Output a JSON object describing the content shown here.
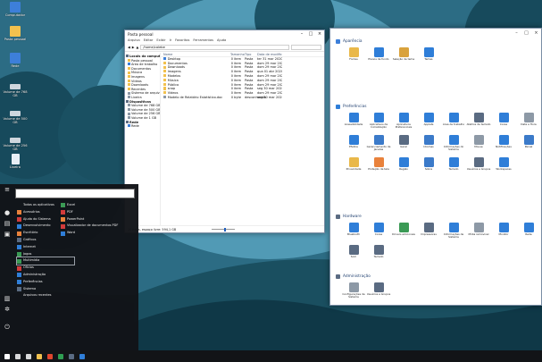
{
  "desktop": {
    "icons": [
      {
        "label": "Computador",
        "color": "#3d7fd9"
      },
      {
        "label": "Pasta pessoal",
        "color": "#f2c14e"
      },
      {
        "label": "Rede",
        "color": "#3d7fd9"
      },
      {
        "label": "Volume de 768 GB",
        "color": "#cfd6dd"
      },
      {
        "label": "Volume de 500 GB",
        "color": "#cfd6dd"
      },
      {
        "label": "Volume de 256 GB",
        "color": "#cfd6dd"
      },
      {
        "label": "Lixeira",
        "color": "#e8eef5"
      }
    ]
  },
  "explorer": {
    "title": "Pasta pessoal",
    "menu": [
      "Arquivo",
      "Editar",
      "Exibir",
      "Ir",
      "Favoritos",
      "Ferramentas",
      "Ajuda"
    ],
    "address": "/home/calebe",
    "nav": [
      {
        "label": "Locais do computador",
        "header": true,
        "color": "#5a6b82"
      },
      {
        "label": "Pasta pessoal",
        "color": "#f2c14e"
      },
      {
        "label": "Área de trabalho",
        "color": "#3d7fd9"
      },
      {
        "label": "Documentos",
        "color": "#f2c14e"
      },
      {
        "label": "Música",
        "color": "#f2c14e"
      },
      {
        "label": "Imagens",
        "color": "#f2c14e"
      },
      {
        "label": "Vídeos",
        "color": "#f2c14e"
      },
      {
        "label": "Downloads",
        "color": "#f2c14e"
      },
      {
        "label": "Recentes",
        "color": "#f2c14e"
      },
      {
        "label": "Sistema de arquivos",
        "color": "#8d99a6"
      },
      {
        "label": "Lixeira",
        "color": "#8d99a6"
      },
      {
        "label": "Dispositivos",
        "header": true,
        "color": "#5a6b82"
      },
      {
        "label": "Volume de 768 GB",
        "color": "#8d99a6"
      },
      {
        "label": "Volume de 500 GB",
        "color": "#8d99a6"
      },
      {
        "label": "Volume de 256 GB",
        "color": "#8d99a6"
      },
      {
        "label": "Volume de 1 GB",
        "color": "#8d99a6"
      },
      {
        "label": "Rede",
        "header": true,
        "color": "#5a6b82"
      },
      {
        "label": "Rede",
        "color": "#3d7fd9"
      }
    ],
    "columns": [
      "Nome",
      "Tamanho",
      "Tipo",
      "Data de modificação"
    ],
    "files": [
      {
        "name": "Desktop",
        "size": "0 item",
        "type": "Pasta",
        "date": "ter 31 mar 2020 23:00:39",
        "color": "#3d7fd9"
      },
      {
        "name": "Documentos",
        "size": "0 item",
        "type": "Pasta",
        "date": "dom 29 mar 2020 22:51:11",
        "color": "#f2c14e"
      },
      {
        "name": "Downloads",
        "size": "0 item",
        "type": "Pasta",
        "date": "dom 29 mar 2020 22:51:11",
        "color": "#f2c14e"
      },
      {
        "name": "Imagens",
        "size": "0 item",
        "type": "Pasta",
        "date": "qua 01 abr 2020 00:03:56",
        "color": "#f2c14e"
      },
      {
        "name": "Modelos",
        "size": "0 item",
        "type": "Pasta",
        "date": "dom 29 mar 2020 22:51:11",
        "color": "#f2c14e"
      },
      {
        "name": "Música",
        "size": "0 item",
        "type": "Pasta",
        "date": "dom 29 mar 2020 22:51:11",
        "color": "#f2c14e"
      },
      {
        "name": "Público",
        "size": "0 item",
        "type": "Pasta",
        "date": "dom 29 mar 2020 22:51:11",
        "color": "#f2c14e"
      },
      {
        "name": "snap",
        "size": "0 item",
        "type": "Pasta",
        "date": "seg 30 mar 2020 01:44:36",
        "color": "#f2c14e"
      },
      {
        "name": "Vídeos",
        "size": "0 item",
        "type": "Pasta",
        "date": "dom 29 mar 2020 22:51:11",
        "color": "#f2c14e"
      },
      {
        "name": "Modelo de Relatório Estatístico.doc",
        "size": "0 byte",
        "type": "desconhecido",
        "date": "seg 30 mar 2020 00:35:52",
        "color": "#8d99a6"
      }
    ],
    "status": "10 itens, espaço livre: 594,1 GB"
  },
  "control_panel": {
    "sections": [
      {
        "title": "Aparência",
        "color": "#3d7fd9",
        "items": [
          {
            "label": "Fontes",
            "color": "#e9b84a"
          },
          {
            "label": "Planos de fundo",
            "color": "#2f7ed8"
          },
          {
            "label": "Seleção de tema",
            "color": "#d9a23c"
          },
          {
            "label": "Temas",
            "color": "#2f7ed8"
          }
        ]
      },
      {
        "title": "Preferências",
        "color": "#2f7ed8",
        "items": [
          {
            "label": "Acessibilidade",
            "color": "#2f7ed8"
          },
          {
            "label": "Aplicativos de Inicialização",
            "color": "#2f7ed8"
          },
          {
            "label": "Aplicativos Preferenciais",
            "color": "#2f7ed8"
          },
          {
            "label": "Applets",
            "color": "#2f7ed8"
          },
          {
            "label": "Área de trabalho",
            "color": "#2f7ed8"
          },
          {
            "label": "Atalhos de teclado",
            "color": "#5a6b82"
          },
          {
            "label": "Cores",
            "color": "#2f7ed8"
          },
          {
            "label": "Data e Hora",
            "color": "#8d99a6"
          },
          {
            "label": "Efeitos",
            "color": "#2f7ed8"
          },
          {
            "label": "Gerenciamento de Janelas",
            "color": "#3b7ac9"
          },
          {
            "label": "Geral",
            "color": "#5a6b82"
          },
          {
            "label": "Idiomas",
            "color": "#3b7ac9"
          },
          {
            "label": "Informações do Sistema",
            "color": "#2f7ed8"
          },
          {
            "label": "Mouse",
            "color": "#8d99a6"
          },
          {
            "label": "Notificações",
            "color": "#2f7ed8"
          },
          {
            "label": "Painel",
            "color": "#3b7ac9"
          },
          {
            "label": "Privacidade",
            "color": "#e9b84a"
          },
          {
            "label": "Proteção de tela",
            "color": "#e9823c"
          },
          {
            "label": "Região",
            "color": "#2f7ed8"
          },
          {
            "label": "Sobre",
            "color": "#3b7ac9"
          },
          {
            "label": "Teclado",
            "color": "#2f7ed8"
          },
          {
            "label": "Usuários e Grupos",
            "color": "#5a6b82"
          },
          {
            "label": "Workspaces",
            "color": "#2f7ed8"
          }
        ]
      },
      {
        "title": "Hardware",
        "color": "#5a6b82",
        "items": [
          {
            "label": "Bluetooth",
            "color": "#2f7ed8"
          },
          {
            "label": "Cores",
            "color": "#2f7ed8"
          },
          {
            "label": "Drivers adicionais",
            "color": "#3b9a55"
          },
          {
            "label": "Impressoras",
            "color": "#5a6b82"
          },
          {
            "label": "Informações de Sistema",
            "color": "#2f7ed8"
          },
          {
            "label": "Mídia removível",
            "color": "#8d99a6"
          },
          {
            "label": "Monitor",
            "color": "#2f7ed8"
          },
          {
            "label": "Rede",
            "color": "#2f7ed8"
          },
          {
            "label": "Som",
            "color": "#5a6b82"
          },
          {
            "label": "Teclado",
            "color": "#5a6b82"
          }
        ]
      },
      {
        "title": "Administração",
        "color": "#5a6b82",
        "items": [
          {
            "label": "Configurações de Sistema",
            "color": "#8d99a6"
          },
          {
            "label": "Usuários e Grupos",
            "color": "#5a6b82"
          }
        ]
      }
    ]
  },
  "startmenu": {
    "col1": [
      {
        "label": "Todos os aplicativos",
        "color": "#00000000"
      },
      {
        "label": "Acessórios",
        "color": "#e9823c"
      },
      {
        "label": "Ajuda do Sistema",
        "color": "#d23b3b"
      },
      {
        "label": "Desenvolvimento",
        "color": "#2f7ed8"
      },
      {
        "label": "Escritório",
        "color": "#e9823c"
      },
      {
        "label": "Gráficos",
        "color": "#5a6b82"
      },
      {
        "label": "Internet",
        "color": "#2f7ed8"
      },
      {
        "label": "Jogos",
        "color": "#3b9a55"
      },
      {
        "label": "Multimídia",
        "color": "#3b9a55"
      },
      {
        "label": "Ofícios",
        "color": "#d23b3b"
      },
      {
        "label": "Administração",
        "color": "#2f7ed8"
      },
      {
        "label": "Preferências",
        "color": "#2f7ed8"
      },
      {
        "label": "Sistema",
        "color": "#5a6b82"
      },
      {
        "label": "Arquivos recentes",
        "color": "#00000000"
      }
    ],
    "col2": [
      {
        "label": "Excel",
        "color": "#3b9a55"
      },
      {
        "label": "PDF",
        "color": "#d23b3b"
      },
      {
        "label": "PowerPoint",
        "color": "#e9823c"
      },
      {
        "label": "Visualizador de documentos PDF",
        "color": "#d23b3b"
      },
      {
        "label": "Word",
        "color": "#2f7ed8"
      }
    ]
  },
  "taskbar": {
    "items": [
      {
        "name": "start-button",
        "color": "#ffffff"
      },
      {
        "name": "search-button",
        "color": "#d9d9d9"
      },
      {
        "name": "task-view-button",
        "color": "#d9d9d9"
      },
      {
        "name": "file-manager-taskbar",
        "color": "#f2c14e"
      },
      {
        "name": "browser-taskbar",
        "color": "#e0462e"
      },
      {
        "name": "chrome-taskbar",
        "color": "#2f9e52"
      },
      {
        "name": "terminal-taskbar",
        "color": "#5a6b82"
      },
      {
        "name": "settings-taskbar",
        "color": "#2f7ed8"
      }
    ]
  }
}
